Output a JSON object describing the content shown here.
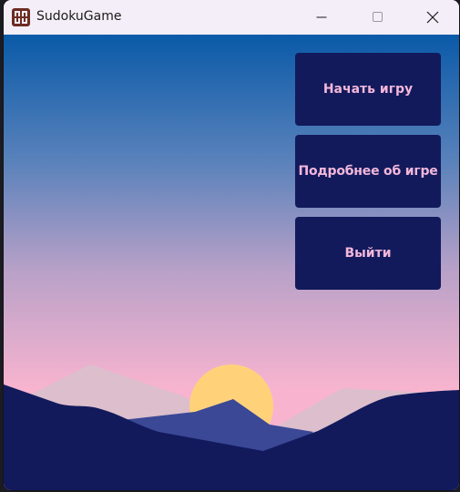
{
  "window": {
    "title": "SudokuGame",
    "icon": "sudoku-app-icon",
    "controls": {
      "minimize_icon": "minimize-icon",
      "maximize_icon": "maximize-icon",
      "close_icon": "close-icon"
    }
  },
  "menu": {
    "start_label": "Начать игру",
    "about_label": "Подробнее об игре",
    "exit_label": "Выйти"
  },
  "colors": {
    "button_bg": "#121a5c",
    "button_text": "#f3b7da",
    "sky_top": "#0a5aa8",
    "sky_bottom": "#f8b4cf",
    "sun": "#ffd27a",
    "mountains_dark": "#121a5c"
  }
}
